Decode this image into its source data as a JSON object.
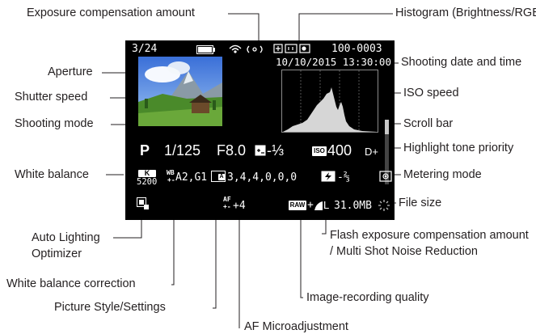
{
  "labels": {
    "exposure_comp": "Exposure compensation amount",
    "histogram": "Histogram (Brightness/RGB)",
    "aperture": "Aperture",
    "shooting_date": "Shooting date and time",
    "shutter_speed": "Shutter speed",
    "iso_speed": "ISO speed",
    "shooting_mode": "Shooting mode",
    "scroll_bar": "Scroll bar",
    "highlight_tone": "Highlight tone priority",
    "white_balance": "White balance",
    "metering_mode": "Metering mode",
    "file_size": "File size",
    "alo": "Auto Lighting Optimizer",
    "flash_comp": "Flash exposure compensation amount / Multi Shot Noise Reduction",
    "wb_correction": "White balance correction",
    "image_quality": "Image-recording quality",
    "picture_style": "Picture Style/Settings",
    "af_micro": "AF Microadjustment"
  },
  "screen": {
    "frame_counter": "3/24",
    "folder_file": "100-0003",
    "date_time": "10/10/2015 13:30:00",
    "shooting_mode": "P",
    "shutter": "1/125",
    "aperture": "F8.0",
    "exp_comp": "-⅓",
    "iso": "400",
    "iso_icon": "ISO",
    "highlight_tone": "D+",
    "wb_badge": "K",
    "wb_kelvin": "5200",
    "wb_correction": "A2,G1",
    "wb_icon": "WB",
    "picture_style_values": "3,4,4,0,0,0",
    "picture_style_icon": "A",
    "flash_comp": "-⅔",
    "af_micro": "+4",
    "af_icon": "AF",
    "raw_icon": "RAW",
    "quality_plus": "+",
    "quality_size": "L",
    "file_size": "31.0MB"
  },
  "colors": {
    "callout_line": "#231f20",
    "screen_bg": "#000000",
    "osd_text": "#ffffff"
  }
}
